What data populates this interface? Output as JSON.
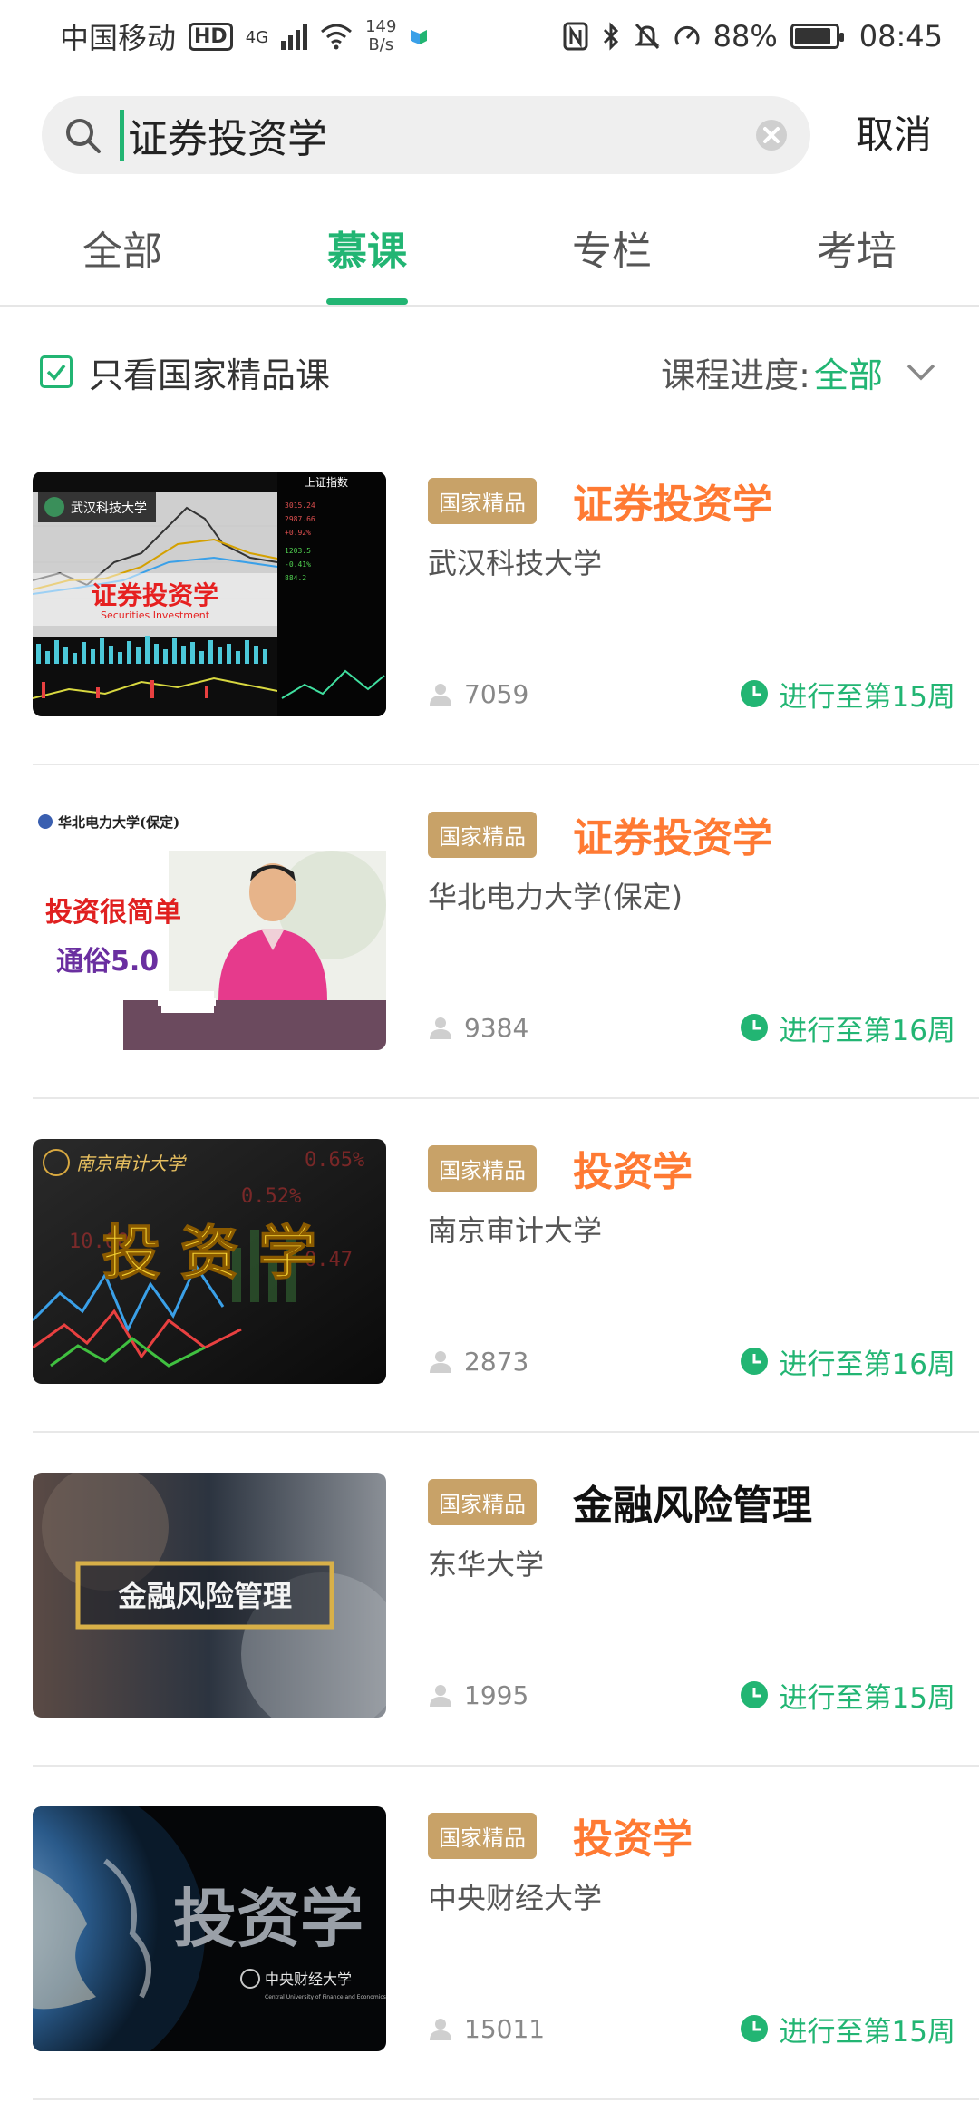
{
  "status_bar": {
    "carrier": "中国移动",
    "hd": "HD",
    "network_type": "4G",
    "net_speed_value": "149",
    "net_speed_unit": "B/s",
    "battery": "88%",
    "time": "08:45"
  },
  "search": {
    "query": "证券投资学",
    "cancel_label": "取消"
  },
  "tabs": [
    {
      "label": "全部",
      "active": false
    },
    {
      "label": "慕课",
      "active": true
    },
    {
      "label": "专栏",
      "active": false
    },
    {
      "label": "考培",
      "active": false
    }
  ],
  "filter": {
    "only_national_label": "只看国家精品课",
    "only_national_checked": true,
    "progress_label": "课程进度:",
    "progress_value": "全部"
  },
  "colors": {
    "accent_green": "#22b573",
    "title_orange": "#ff7a33",
    "badge_gold": "#c8a268"
  },
  "courses": [
    {
      "badge": "国家精品",
      "title": "证券投资学",
      "school": "武汉科技大学",
      "students": "7059",
      "progress": "进行至第15周",
      "thumb_text": "证券投资学",
      "thumb_subtext": "Securities Investment",
      "thumb_logo_text": "武汉科技大学",
      "thumb_index_text": "上证指数"
    },
    {
      "badge": "国家精品",
      "title": "证券投资学",
      "school": "华北电力大学(保定)",
      "students": "9384",
      "progress": "进行至第16周",
      "thumb_logo_text": "华北电力大学(保定)",
      "thumb_line1": "投资很简单",
      "thumb_line2": "通俗5.0"
    },
    {
      "badge": "国家精品",
      "title": "投资学",
      "school": "南京审计大学",
      "students": "2873",
      "progress": "进行至第16周",
      "thumb_logo_text": "南京审计大学",
      "thumb_text": "投 资 学"
    },
    {
      "badge": "国家精品",
      "title": "金融风险管理",
      "school": "东华大学",
      "students": "1995",
      "progress": "进行至第15周",
      "title_dark": true,
      "thumb_text": "金融风险管理"
    },
    {
      "badge": "国家精品",
      "title": "投资学",
      "school": "中央财经大学",
      "students": "15011",
      "progress": "进行至第15周",
      "thumb_text": "投资学",
      "thumb_logo_text": "中央财经大学",
      "thumb_subtext": "Central University of Finance and Economics"
    }
  ]
}
